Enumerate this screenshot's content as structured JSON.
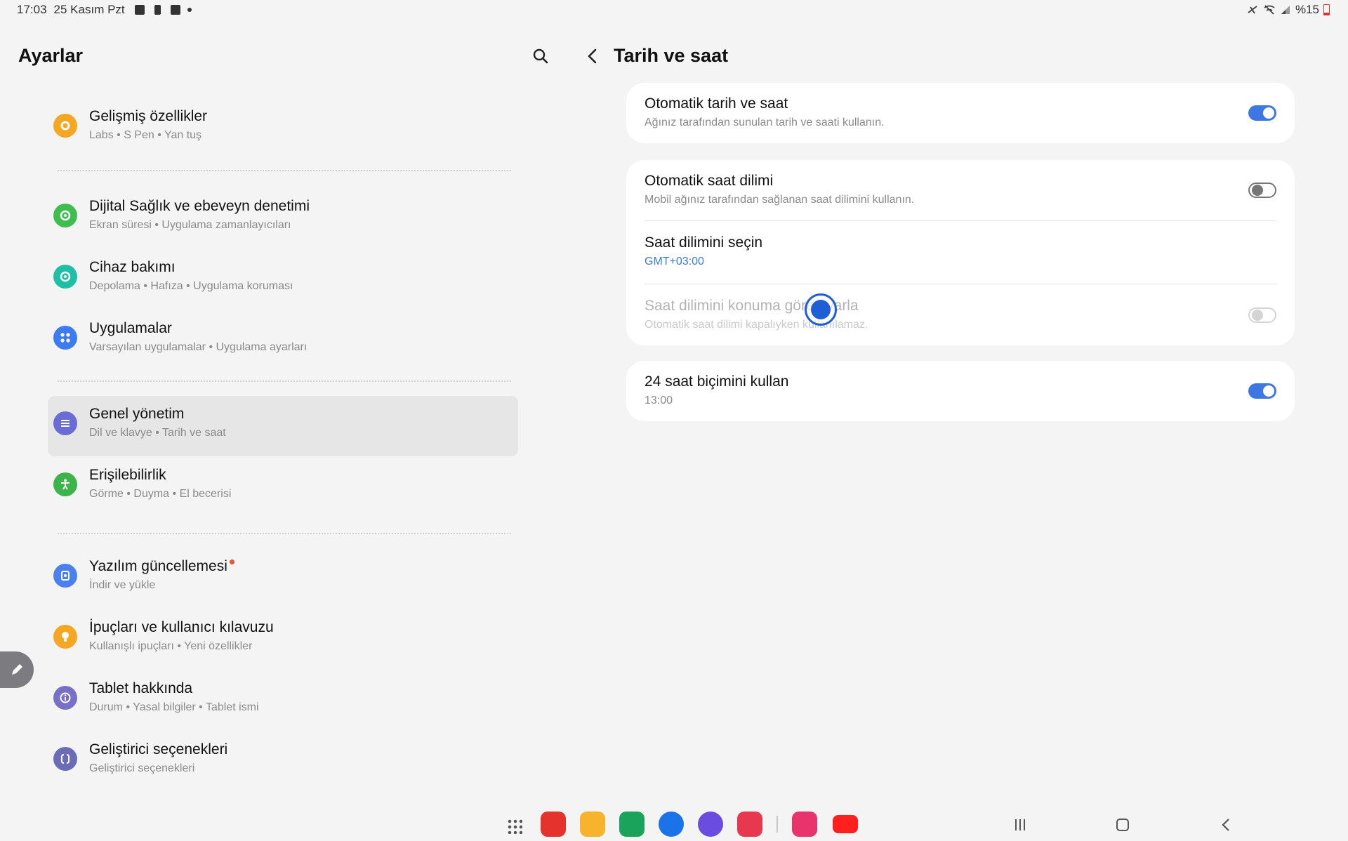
{
  "status_bar": {
    "time": "17:03",
    "date": "25 Kasım Pzt",
    "battery": "%15"
  },
  "settings": {
    "title": "Ayarlar",
    "items": [
      {
        "title": "Gelişmiş özellikler",
        "subtitle": "Labs  •  S Pen  •  Yan tuş",
        "icon": "advanced-features-icon",
        "color": "#f5a623"
      },
      {
        "title": "Dijital Sağlık ve ebeveyn denetimi",
        "subtitle": "Ekran süresi  •  Uygulama zamanlayıcıları",
        "icon": "digital-wellbeing-icon",
        "color": "#3fbd4f"
      },
      {
        "title": "Cihaz bakımı",
        "subtitle": "Depolama  •  Hafıza  •  Uygulama koruması",
        "icon": "device-care-icon",
        "color": "#1fbfa6"
      },
      {
        "title": "Uygulamalar",
        "subtitle": "Varsayılan uygulamalar  •  Uygulama ayarları",
        "icon": "apps-icon",
        "color": "#3d7bf0"
      },
      {
        "title": "Genel yönetim",
        "subtitle": "Dil ve klavye  •  Tarih ve saat",
        "icon": "general-management-icon",
        "color": "#6b6bd6"
      },
      {
        "title": "Erişilebilirlik",
        "subtitle": "Görme  •  Duyma  •  El becerisi",
        "icon": "accessibility-icon",
        "color": "#3cb44b"
      },
      {
        "title": "Yazılım güncellemesi",
        "subtitle": "İndir ve yükle",
        "icon": "software-update-icon",
        "color": "#4b80f0"
      },
      {
        "title": "İpuçları ve kullanıcı kılavuzu",
        "subtitle": "Kullanışlı ipuçları  •  Yeni özellikler",
        "icon": "tips-icon",
        "color": "#f5a623"
      },
      {
        "title": "Tablet hakkında",
        "subtitle": "Durum  •  Yasal bilgiler  •  Tablet ismi",
        "icon": "about-tablet-icon",
        "color": "#7a6fc6"
      },
      {
        "title": "Geliştirici seçenekleri",
        "subtitle": "Geliştirici seçenekleri",
        "icon": "developer-options-icon",
        "color": "#6b6bb8"
      }
    ]
  },
  "detail": {
    "title": "Tarih ve saat",
    "auto_datetime": {
      "title": "Otomatik tarih ve saat",
      "subtitle": "Ağınız tarafından sunulan tarih ve saati kullanın.",
      "enabled": true
    },
    "auto_timezone": {
      "title": "Otomatik saat dilimi",
      "subtitle": "Mobil ağınız tarafından sağlanan saat dilimini kullanın.",
      "enabled": false
    },
    "select_timezone": {
      "title": "Saat dilimini seçin",
      "value": "GMT+03:00"
    },
    "timezone_by_location": {
      "title": "Saat dilimini konuma göre ayarla",
      "subtitle": "Otomatik saat dilimi kapalıyken kullanılamaz.",
      "enabled": false,
      "disabled": true
    },
    "use_24h": {
      "title": "24 saat biçimini kullan",
      "subtitle": "13:00",
      "enabled": true
    }
  },
  "accent_color": "#3e76e3",
  "taskbar": {
    "apps": [
      {
        "name": "flipboard-app-icon",
        "color": "#e5322d"
      },
      {
        "name": "my-files-app-icon",
        "color": "#f7b32b"
      },
      {
        "name": "phone-app-icon",
        "color": "#19a35b"
      },
      {
        "name": "messages-app-icon",
        "color": "#1a73e8"
      },
      {
        "name": "samsung-internet-app-icon",
        "color": "#6a4de0"
      },
      {
        "name": "camera-app-icon",
        "color": "#e8384f"
      },
      {
        "name": "gallery-app-icon",
        "color": "#e8336d"
      },
      {
        "name": "youtube-app-icon",
        "color": "#ff1f1f"
      }
    ]
  }
}
